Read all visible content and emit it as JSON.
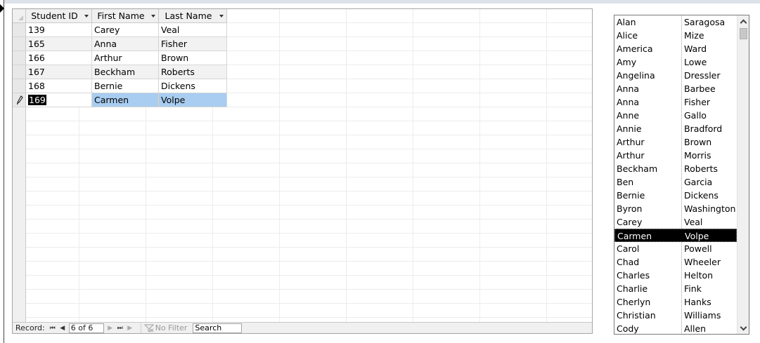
{
  "datasheet": {
    "columns": [
      {
        "label": "Student ID"
      },
      {
        "label": "First Name"
      },
      {
        "label": "Last Name"
      }
    ],
    "rows": [
      {
        "id": "139",
        "first": "Carey",
        "last": "Veal"
      },
      {
        "id": "165",
        "first": "Anna",
        "last": "Fisher"
      },
      {
        "id": "166",
        "first": "Arthur",
        "last": "Brown"
      },
      {
        "id": "167",
        "first": "Beckham",
        "last": "Roberts"
      },
      {
        "id": "168",
        "first": "Bernie",
        "last": "Dickens"
      },
      {
        "id": "169",
        "first": "Carmen",
        "last": "Volpe"
      }
    ],
    "current_row_index": 5,
    "row_selector_icon": "pencil-icon",
    "highlight_color": "#a8cdf0"
  },
  "navigation": {
    "record_label": "Record:",
    "current_record": "6 of 6",
    "no_filter_label": "No Filter",
    "search_placeholder": "Search",
    "icons": [
      "first-record-icon",
      "previous-record-icon",
      "next-record-icon",
      "last-record-icon",
      "new-record-icon",
      "filter-icon"
    ]
  },
  "listbox": {
    "items": [
      {
        "first": "Alan",
        "last": "Saragosa"
      },
      {
        "first": "Alice",
        "last": "Mize"
      },
      {
        "first": "America",
        "last": "Ward"
      },
      {
        "first": "Amy",
        "last": "Lowe"
      },
      {
        "first": "Angelina",
        "last": "Dressler"
      },
      {
        "first": "Anna",
        "last": "Barbee"
      },
      {
        "first": "Anna",
        "last": "Fisher"
      },
      {
        "first": "Anne",
        "last": "Gallo"
      },
      {
        "first": "Annie",
        "last": "Bradford"
      },
      {
        "first": "Arthur",
        "last": "Brown"
      },
      {
        "first": "Arthur",
        "last": "Morris"
      },
      {
        "first": "Beckham",
        "last": "Roberts"
      },
      {
        "first": "Ben",
        "last": "Garcia"
      },
      {
        "first": "Bernie",
        "last": "Dickens"
      },
      {
        "first": "Byron",
        "last": "Washington"
      },
      {
        "first": "Carey",
        "last": "Veal"
      },
      {
        "first": "Carmen",
        "last": "Volpe"
      },
      {
        "first": "Carol",
        "last": "Powell"
      },
      {
        "first": "Chad",
        "last": "Wheeler"
      },
      {
        "first": "Charles",
        "last": "Helton"
      },
      {
        "first": "Charlie",
        "last": "Fink"
      },
      {
        "first": "Cherlyn",
        "last": "Hanks"
      },
      {
        "first": "Christian",
        "last": "Williams"
      },
      {
        "first": "Cody",
        "last": "Allen"
      }
    ],
    "selected_index": 16
  }
}
